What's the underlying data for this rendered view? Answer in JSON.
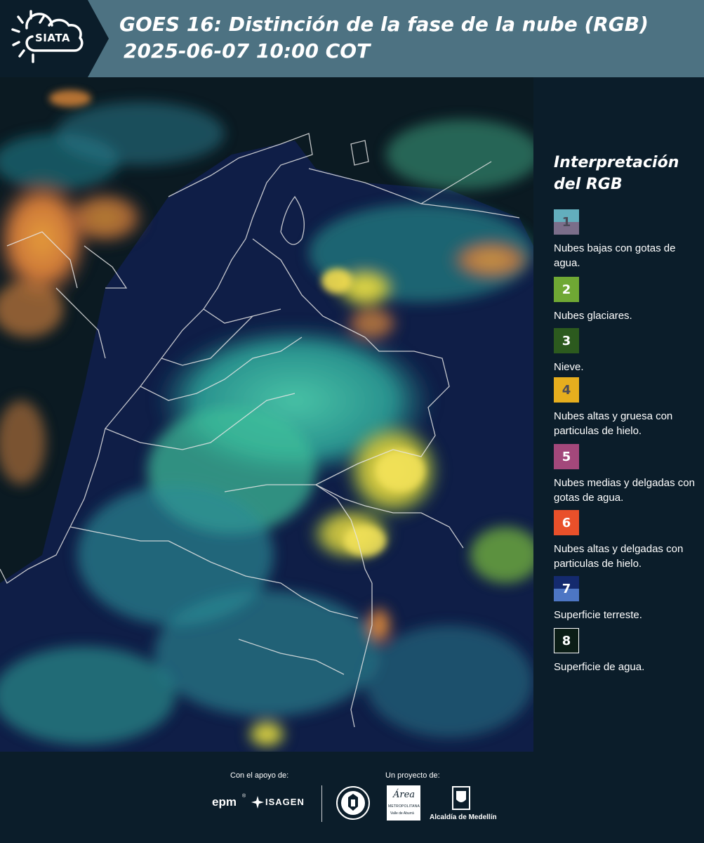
{
  "header": {
    "logo_text": "SIATA",
    "title_line1": "GOES 16: Distinción de la fase de la nube (RGB)",
    "title_line2": "2025-06-07 10:00 COT",
    "bg_color": "#4d7282"
  },
  "map": {
    "icon": "satellite-rgb-map"
  },
  "legend": {
    "title": "Interpretación del RGB",
    "items": [
      {
        "number": "1",
        "label": "Nubes bajas con gotas de agua.",
        "color_top": "#63aebd",
        "color_bottom": "#7b6e8a",
        "number_color": "#4a4a58"
      },
      {
        "number": "2",
        "label": "Nubes glaciares.",
        "color_top": "#6fa834",
        "color_bottom": "#6fa834",
        "number_color": "#ffffff"
      },
      {
        "number": "3",
        "label": "Nieve.",
        "color_top": "#2c5a1e",
        "color_bottom": "#2c5a1e",
        "number_color": "#ffffff"
      },
      {
        "number": "4",
        "label": "Nubes altas y gruesa con particulas de hielo.",
        "color_top": "#e6ae1e",
        "color_bottom": "#e6ae1e",
        "number_color": "#4a4a58"
      },
      {
        "number": "5",
        "label": "Nubes medias y delgadas con gotas de agua.",
        "color_top": "#a3487b",
        "color_bottom": "#a3487b",
        "number_color": "#ffffff"
      },
      {
        "number": "6",
        "label": "Nubes altas y delgadas con particulas de hielo.",
        "color_top": "#e9502a",
        "color_bottom": "#e9502a",
        "number_color": "#ffffff"
      },
      {
        "number": "7",
        "label": "Superficie terreste.",
        "color_top": "#142a6e",
        "color_bottom": "#4d76c4",
        "number_color": "#ffffff"
      },
      {
        "number": "8",
        "label": "Superficie de agua.",
        "color_top": "#0b1d16",
        "color_bottom": "#0b1d16",
        "number_color": "#ffffff"
      }
    ]
  },
  "footer": {
    "support_caption": "Con el apoyo de:",
    "project_caption": "Un proyecto de:",
    "sponsor_epm": "epm",
    "sponsor_isagen": "ISAGEN",
    "partner_area_top": "Área",
    "partner_area_mid": "METROPOLITANA",
    "partner_area_bottom": "Valle de Aburrá",
    "partner_alcaldia": "Alcaldía de Medellín"
  }
}
